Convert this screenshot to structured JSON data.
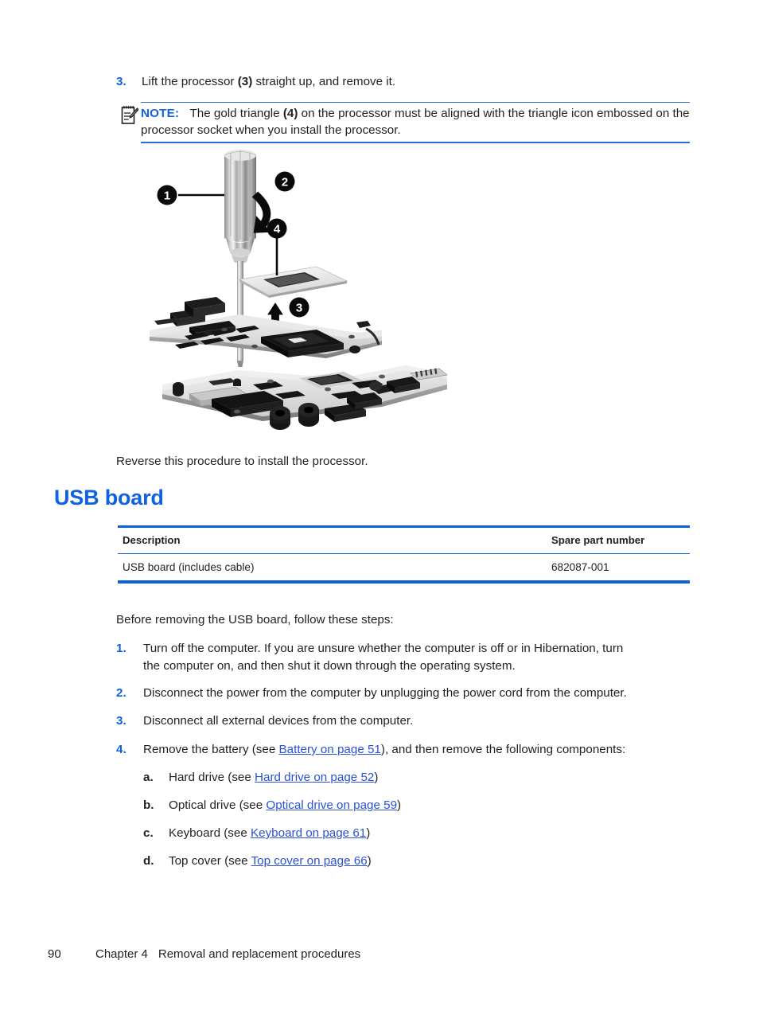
{
  "steps_top": [
    {
      "marker": "3.",
      "text_parts": [
        {
          "t": "Lift the processor ",
          "b": false
        },
        {
          "t": "(3)",
          "b": true
        },
        {
          "t": " straight up, and remove it.",
          "b": false
        }
      ],
      "text": "Lift the processor (3) straight up, and remove it."
    }
  ],
  "note": {
    "label": "NOTE:",
    "icon": "note-pencil-icon",
    "text_line1": "The gold triangle (4) on the processor must be aligned with the triangle icon embossed",
    "text_line2": "on the processor socket when you install the processor.",
    "bold_fragment": "(4)",
    "pre_bold": "The gold triangle ",
    "post_bold": " on the processor must be aligned with the triangle icon embossed on the processor socket when you install the processor."
  },
  "figure": {
    "name": "processor-removal-illustration",
    "alt": "Exploded view of screwdriver, processor and system board",
    "callouts": [
      {
        "id": "1",
        "meaning": "screwdriver-handle"
      },
      {
        "id": "2",
        "meaning": "rotation-arrow"
      },
      {
        "id": "3",
        "meaning": "lift-up-arrow"
      },
      {
        "id": "4",
        "meaning": "processor-gold-triangle"
      }
    ]
  },
  "reverse_note": "Reverse this procedure to install the processor.",
  "heading": "USB board",
  "table": {
    "name": "usb-board-spare-parts",
    "columns": [
      "Description",
      "Spare part number"
    ],
    "rows": [
      {
        "description": "USB board (includes cable)",
        "part_number": "682087-001"
      }
    ]
  },
  "intro": "Before removing the USB board, follow these steps:",
  "steps": [
    {
      "marker": "1.",
      "line1": "Turn off the computer. If you are unsure whether the computer is off or in Hibernation, turn",
      "line2": "the computer on, and then shut it down through the operating system."
    },
    {
      "marker": "2.",
      "line1": "Disconnect the power from the computer by unplugging the power cord from the computer.",
      "line2": ""
    },
    {
      "marker": "3.",
      "line1": "Disconnect all external devices from the computer.",
      "line2": ""
    }
  ],
  "step4": {
    "marker": "4.",
    "pre": "Remove the battery (see ",
    "link": "Battery on page 51",
    "post": "), and then remove the following components:"
  },
  "substeps": [
    {
      "marker": "a.",
      "pre": "Hard drive (see ",
      "link": "Hard drive on page 52",
      "post": ")"
    },
    {
      "marker": "b.",
      "pre": "Optical drive (see ",
      "link": "Optical drive on page 59",
      "post": ")"
    },
    {
      "marker": "c.",
      "pre": "Keyboard (see ",
      "link": "Keyboard on page 61",
      "post": ")"
    },
    {
      "marker": "d.",
      "pre": "Top cover (see ",
      "link": "Top cover on page 66",
      "post": ")"
    }
  ],
  "footer": {
    "page_number": "90",
    "chapter": "Chapter 4",
    "chapter_title": "Removal and replacement procedures"
  },
  "colors": {
    "heading_blue": "#0f62e0",
    "rule_blue": "#0a63d8",
    "link_blue": "#2a51d6",
    "text_black": "#231f20"
  }
}
